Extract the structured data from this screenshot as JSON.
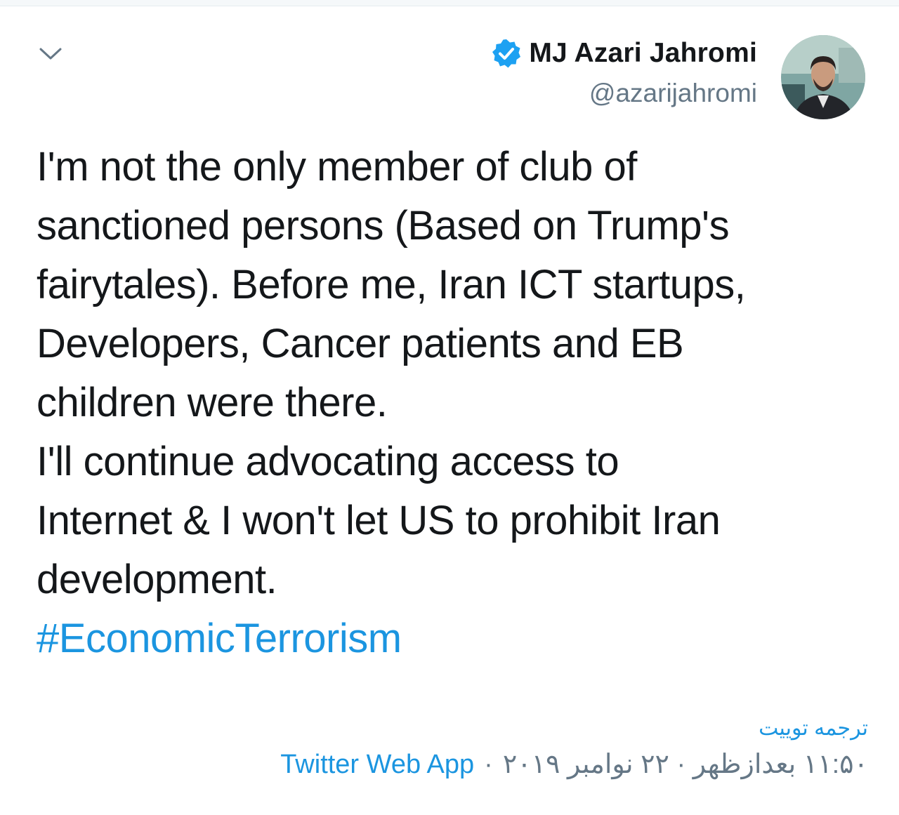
{
  "author": {
    "display_name": "MJ Azari Jahromi",
    "handle": "@azarijahromi",
    "verified": true
  },
  "tweet": {
    "lines": [
      "I'm not the only member of club of",
      "sanctioned persons (Based on Trump's",
      "fairytales). Before me, Iran ICT startups,",
      "Developers, Cancer patients and EB",
      "children were there.",
      "I'll continue advocating access to",
      "Internet & I won't let US to prohibit Iran",
      "development."
    ],
    "hashtag": "#EconomicTerrorism"
  },
  "translate_label": "ترجمه توییت",
  "meta": {
    "timestamp": "۱۱:۵۰ بعدازظهر · ۲۲ نوامبر ۲۰۱۹",
    "separator": "·",
    "source": "Twitter Web App"
  },
  "icons": {
    "menu": "chevron-down-icon",
    "verified": "verified-badge-icon"
  },
  "colors": {
    "accent": "#1b95e0",
    "verified": "#1da1f2",
    "text": "#14171a",
    "secondary": "#657786"
  }
}
